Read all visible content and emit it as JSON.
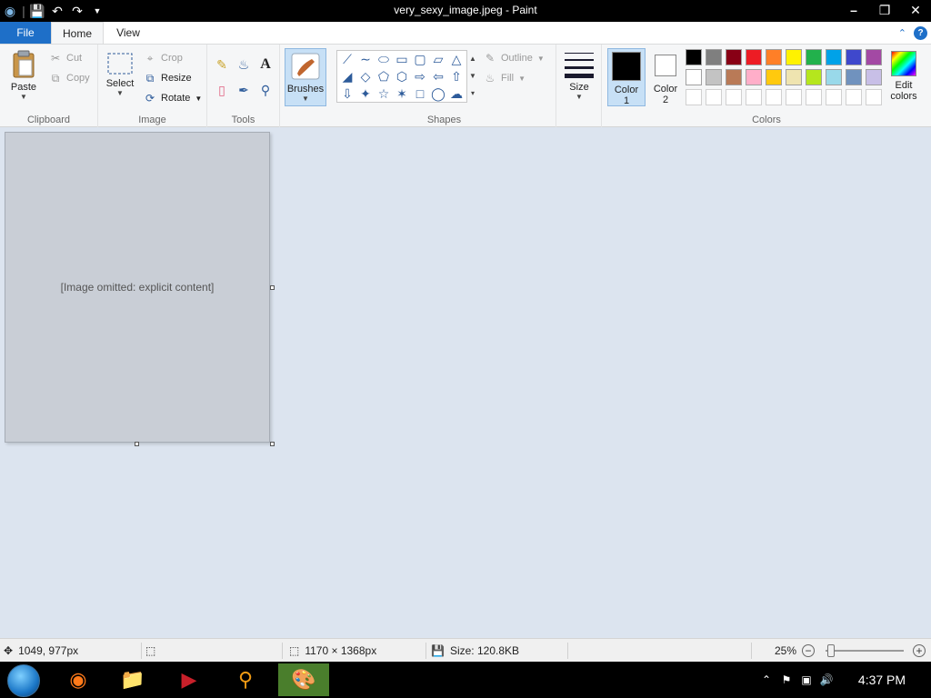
{
  "window": {
    "title": "very_sexy_image.jpeg - Paint"
  },
  "quick_access": {
    "icons": [
      "paint-app-icon",
      "save-icon",
      "undo-icon",
      "redo-icon",
      "customize-qat-icon"
    ]
  },
  "tabs": [
    {
      "label": "File"
    },
    {
      "label": "Home"
    },
    {
      "label": "View"
    }
  ],
  "clipboard": {
    "paste_label": "Paste",
    "cut_label": "Cut",
    "copy_label": "Copy",
    "group_label": "Clipboard"
  },
  "image_group": {
    "select_label": "Select",
    "crop_label": "Crop",
    "resize_label": "Resize",
    "rotate_label": "Rotate",
    "group_label": "Image"
  },
  "tools_group": {
    "group_label": "Tools",
    "text_tool_glyph": "A"
  },
  "brushes": {
    "label": "Brushes"
  },
  "shapes_group": {
    "outline_label": "Outline",
    "fill_label": "Fill",
    "group_label": "Shapes"
  },
  "size": {
    "label": "Size"
  },
  "colors_group": {
    "color1_label": "Color",
    "color1_num": "1",
    "color2_label": "Color",
    "color2_num": "2",
    "color1_value": "#000000",
    "color2_value": "#ffffff",
    "edit_colors_label": "Edit colors",
    "group_label": "Colors",
    "palette_row1": [
      "#000000",
      "#7f7f7f",
      "#880015",
      "#ed1c24",
      "#ff7f27",
      "#fff200",
      "#22b14c",
      "#00a2e8",
      "#3f48cc",
      "#a349a4"
    ],
    "palette_row2": [
      "#ffffff",
      "#c3c3c3",
      "#b97a57",
      "#ffaec9",
      "#ffc90e",
      "#efe4b0",
      "#b5e61d",
      "#99d9ea",
      "#7092be",
      "#c8bfe7"
    ]
  },
  "canvas": {
    "placeholder_text": "[Image omitted: explicit content]"
  },
  "status": {
    "cursor_pos": "1049, 977px",
    "dimensions": "1170 × 1368px",
    "file_size": "Size: 120.8KB",
    "zoom": "25%",
    "zoom_fraction": 0.07
  },
  "taskbar": {
    "apps": [
      "firefox-icon",
      "file-explorer-icon",
      "game-app-icon",
      "search-app-icon",
      "paint-app-icon"
    ],
    "time": "4:37 PM"
  }
}
